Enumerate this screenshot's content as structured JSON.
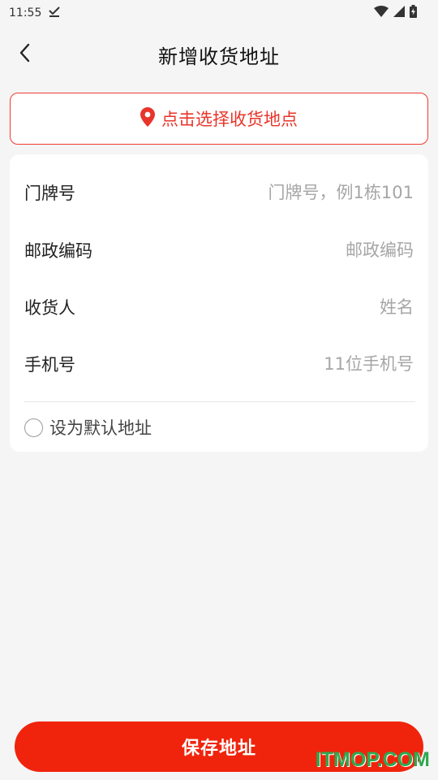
{
  "status_bar": {
    "time": "11:55",
    "icons": [
      "download-done-icon",
      "wifi-icon",
      "signal-icon",
      "battery-charging-icon"
    ]
  },
  "header": {
    "title": "新增收货地址",
    "back_icon": "chevron-left-icon"
  },
  "location_picker": {
    "label": "点击选择收货地点",
    "icon": "location-pin-icon",
    "accent_color": "#e8342a"
  },
  "form": {
    "fields": [
      {
        "label": "门牌号",
        "placeholder": "门牌号，例1栋101",
        "value": ""
      },
      {
        "label": "邮政编码",
        "placeholder": "邮政编码",
        "value": ""
      },
      {
        "label": "收货人",
        "placeholder": "姓名",
        "value": ""
      },
      {
        "label": "手机号",
        "placeholder": "11位手机号",
        "value": ""
      }
    ],
    "default_address": {
      "label": "设为默认地址",
      "checked": false
    }
  },
  "save_button": {
    "label": "保存地址",
    "color": "#f0240c"
  },
  "watermark": "ITMOP.COM"
}
